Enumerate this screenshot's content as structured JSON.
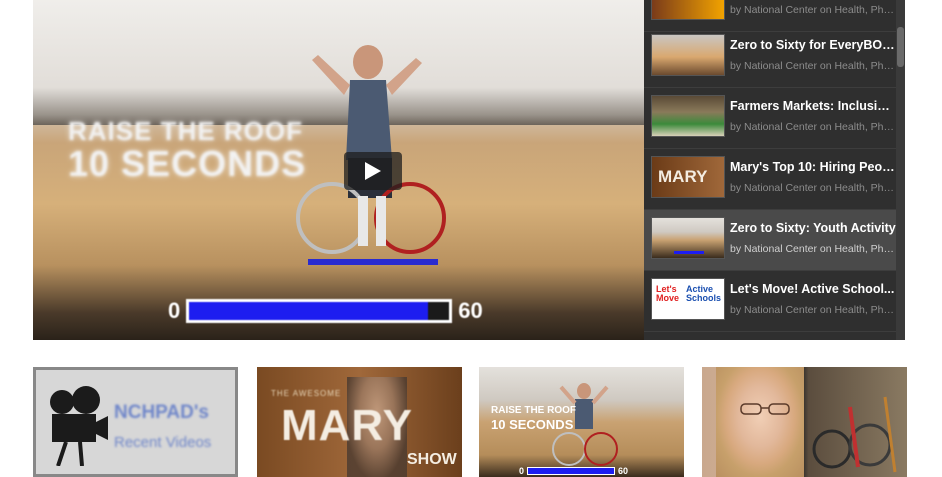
{
  "player": {
    "overlay_line1": "RAISE THE ROOF",
    "overlay_line2": "10 SECONDS",
    "counter_start": "0",
    "counter_end": "60",
    "counter_progress": 0.92,
    "play_icon": "play-icon"
  },
  "playlist": {
    "items": [
      {
        "title": "",
        "byline": "by National Center on Health, Phy..."
      },
      {
        "title": "Zero to Sixty for EveryBODY...",
        "byline": "by National Center on Health, Phy..."
      },
      {
        "title": "Farmers Markets: Inclusion...",
        "byline": "by National Center on Health, Phy..."
      },
      {
        "title": "Mary's Top 10: Hiring Peop...",
        "byline": "by National Center on Health, Phy..."
      },
      {
        "title": "Zero to Sixty: Youth Activity",
        "byline": "by National Center on Health, Phy..."
      },
      {
        "title": "Let's Move! Active School...",
        "byline": "by National Center on Health, Phy..."
      }
    ],
    "active_index": 4
  },
  "thumbs": {
    "tile1": {
      "line1": "NCHPAD's",
      "line2": "Recent Videos"
    },
    "tile2": {
      "the": "THE AWESOME",
      "mary": "MARY",
      "show": "SHOW"
    },
    "tile3": {
      "line1": "RAISE THE ROOF",
      "line2": "10 SECONDS",
      "start": "0",
      "end": "60"
    },
    "tile4": {}
  },
  "colors": {
    "progress": "#1d1df0",
    "playlist_bg": "#2f2f2f",
    "active_row": "#4a4a4a"
  }
}
